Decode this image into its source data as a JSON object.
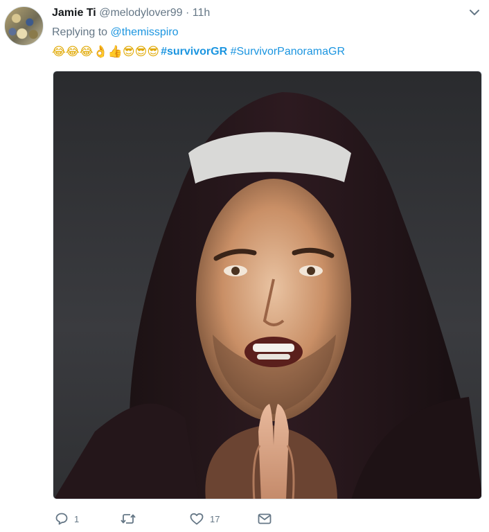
{
  "tweet": {
    "display_name": "Jamie Ti",
    "handle": "@melodylover99",
    "separator": "·",
    "time": "11h",
    "reply_prefix": "Replying to",
    "reply_to": "@themisspiro",
    "emojis": "😂😂😂👌👍😎😎😎",
    "hashtags": [
      "#survivorGR",
      "#SurvivorPanoramaGR"
    ]
  },
  "actions": {
    "reply_count": "1",
    "retweet_count": "",
    "like_count": "17"
  },
  "icons": {
    "caret": "chevron-down-icon",
    "reply": "reply-icon",
    "retweet": "retweet-icon",
    "like": "heart-icon",
    "dm": "envelope-icon"
  },
  "colors": {
    "link": "#1b95e0",
    "secondary": "#657786",
    "text": "#14171a"
  }
}
